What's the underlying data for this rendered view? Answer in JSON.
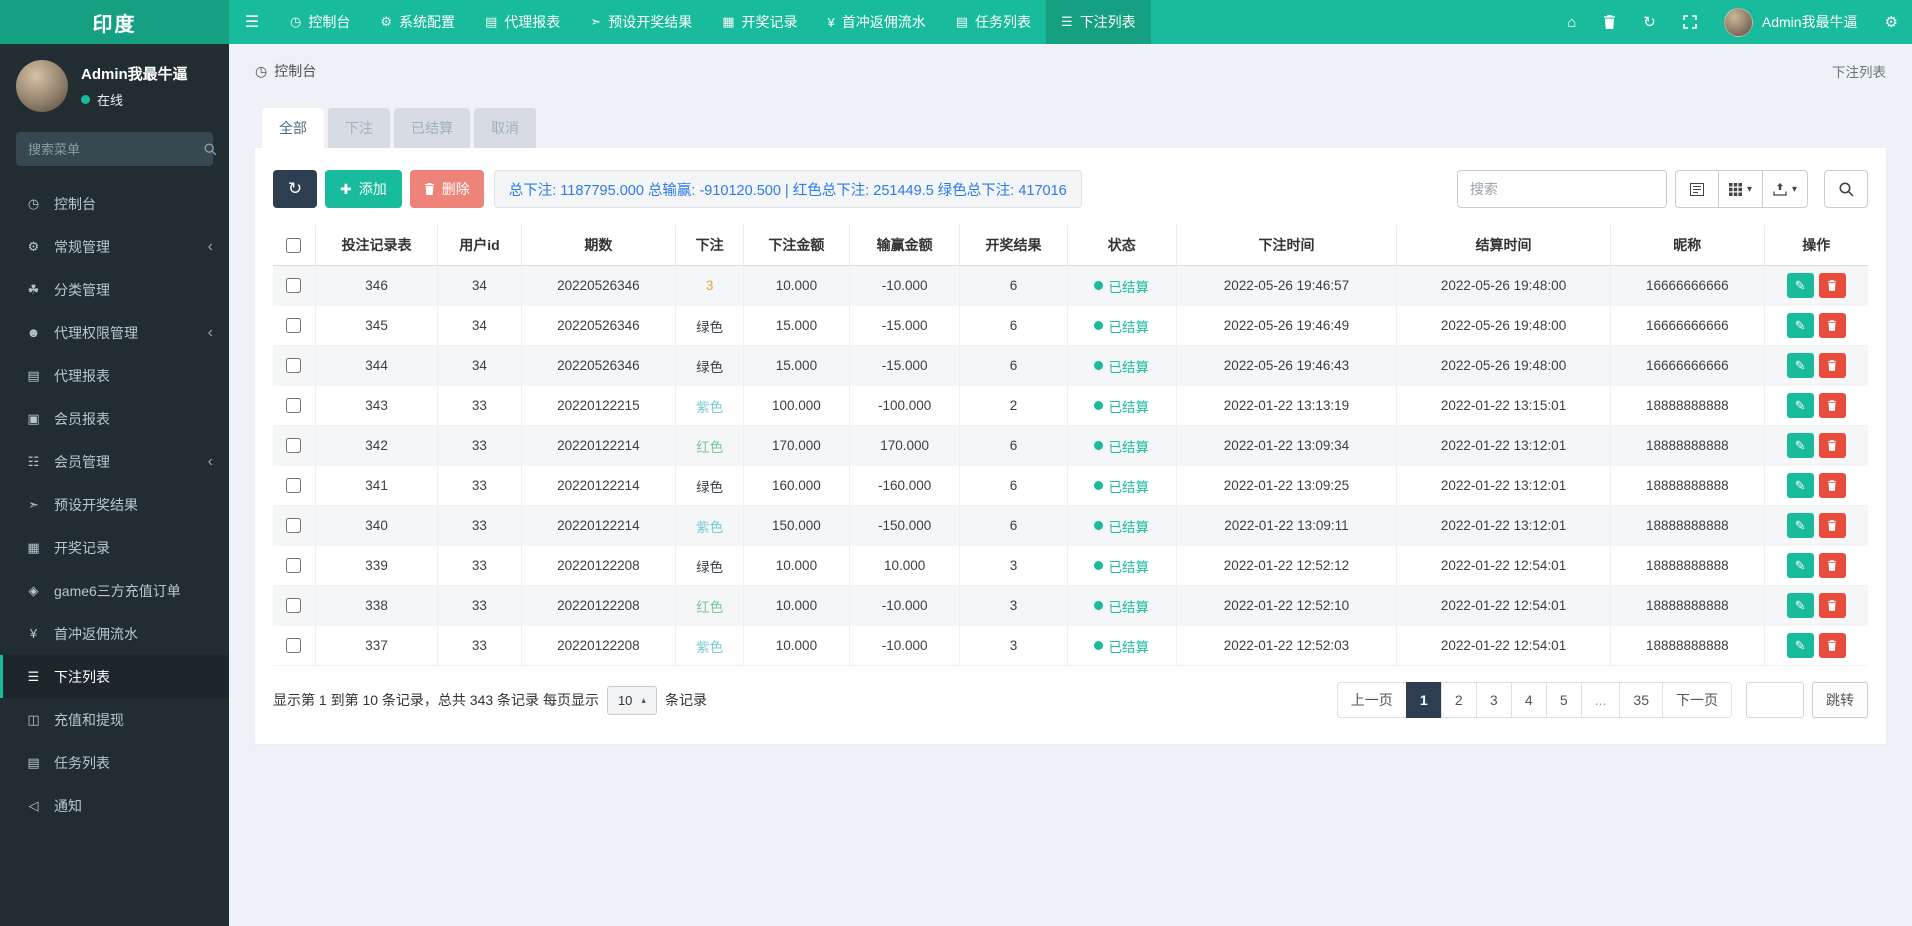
{
  "app": {
    "logo": "印度",
    "admin_name": "Admin我最牛逼"
  },
  "topnav": {
    "items": [
      {
        "label": "控制台",
        "icon": "gauge-icon"
      },
      {
        "label": "系统配置",
        "icon": "gears-icon"
      },
      {
        "label": "代理报表",
        "icon": "book-icon"
      },
      {
        "label": "预设开奖结果",
        "icon": "send-icon"
      },
      {
        "label": "开奖记录",
        "icon": "calendar-icon"
      },
      {
        "label": "首冲返佣流水",
        "icon": "yen-icon"
      },
      {
        "label": "任务列表",
        "icon": "book-icon"
      },
      {
        "label": "下注列表",
        "icon": "list-icon",
        "active": true
      }
    ]
  },
  "sidebar": {
    "user": {
      "name": "Admin我最牛逼",
      "status": "在线"
    },
    "search_placeholder": "搜索菜单",
    "items": [
      {
        "label": "控制台",
        "icon": "gauge-icon"
      },
      {
        "label": "常规管理",
        "icon": "gears-icon",
        "chevron": true
      },
      {
        "label": "分类管理",
        "icon": "leaf-icon"
      },
      {
        "label": "代理权限管理",
        "icon": "users-icon",
        "chevron": true
      },
      {
        "label": "代理报表",
        "icon": "book-icon"
      },
      {
        "label": "会员报表",
        "icon": "idcard-icon"
      },
      {
        "label": "会员管理",
        "icon": "grid-list-icon",
        "chevron": true
      },
      {
        "label": "预设开奖结果",
        "icon": "send-icon"
      },
      {
        "label": "开奖记录",
        "icon": "calendar-icon"
      },
      {
        "label": "game6三方充值订单",
        "icon": "gem-icon"
      },
      {
        "label": "首冲返佣流水",
        "icon": "yen-icon"
      },
      {
        "label": "下注列表",
        "icon": "list-icon",
        "active": true
      },
      {
        "label": "充值和提现",
        "icon": "money-icon"
      },
      {
        "label": "任务列表",
        "icon": "book-icon"
      },
      {
        "label": "通知",
        "icon": "bullhorn-icon"
      }
    ]
  },
  "breadcrumb": {
    "left": "控制台",
    "right": "下注列表"
  },
  "tabs": [
    {
      "label": "全部",
      "active": true
    },
    {
      "label": "下注"
    },
    {
      "label": "已结算"
    },
    {
      "label": "取消"
    }
  ],
  "toolbar": {
    "add_label": "添加",
    "delete_label": "删除",
    "summary": "总下注: 1187795.000 总输赢: -910120.500 | 红色总下注: 251449.5 绿色总下注: 417016",
    "search_placeholder": "搜索"
  },
  "table": {
    "headers": [
      {
        "label": "投注记录表"
      },
      {
        "label": "用户id"
      },
      {
        "label": "期数"
      },
      {
        "label": "下注"
      },
      {
        "label": "下注金额"
      },
      {
        "label": "输赢金额"
      },
      {
        "label": "开奖结果"
      },
      {
        "label": "状态"
      },
      {
        "label": "下注时间"
      },
      {
        "label": "结算时间"
      },
      {
        "label": "昵称"
      },
      {
        "label": "操作"
      }
    ],
    "rows": [
      {
        "record_id": "346",
        "user_id": "34",
        "period": "20220526346",
        "bet": "3",
        "bet_class": "bet-num",
        "amount": "10.000",
        "win_loss": "-10.000",
        "result": "6",
        "status": "已结算",
        "bet_time": "2022-05-26 19:46:57",
        "settle_time": "2022-05-26 19:48:00",
        "nickname": "16666666666"
      },
      {
        "record_id": "345",
        "user_id": "34",
        "period": "20220526346",
        "bet": "绿色",
        "bet_class": "bet-green",
        "amount": "15.000",
        "win_loss": "-15.000",
        "result": "6",
        "status": "已结算",
        "bet_time": "2022-05-26 19:46:49",
        "settle_time": "2022-05-26 19:48:00",
        "nickname": "16666666666"
      },
      {
        "record_id": "344",
        "user_id": "34",
        "period": "20220526346",
        "bet": "绿色",
        "bet_class": "bet-green",
        "amount": "15.000",
        "win_loss": "-15.000",
        "result": "6",
        "status": "已结算",
        "bet_time": "2022-05-26 19:46:43",
        "settle_time": "2022-05-26 19:48:00",
        "nickname": "16666666666"
      },
      {
        "record_id": "343",
        "user_id": "33",
        "period": "20220122215",
        "bet": "紫色",
        "bet_class": "bet-purple",
        "amount": "100.000",
        "win_loss": "-100.000",
        "result": "2",
        "status": "已结算",
        "bet_time": "2022-01-22 13:13:19",
        "settle_time": "2022-01-22 13:15:01",
        "nickname": "18888888888"
      },
      {
        "record_id": "342",
        "user_id": "33",
        "period": "20220122214",
        "bet": "红色",
        "bet_class": "bet-red",
        "amount": "170.000",
        "win_loss": "170.000",
        "result": "6",
        "status": "已结算",
        "bet_time": "2022-01-22 13:09:34",
        "settle_time": "2022-01-22 13:12:01",
        "nickname": "18888888888"
      },
      {
        "record_id": "341",
        "user_id": "33",
        "period": "20220122214",
        "bet": "绿色",
        "bet_class": "bet-green",
        "amount": "160.000",
        "win_loss": "-160.000",
        "result": "6",
        "status": "已结算",
        "bet_time": "2022-01-22 13:09:25",
        "settle_time": "2022-01-22 13:12:01",
        "nickname": "18888888888"
      },
      {
        "record_id": "340",
        "user_id": "33",
        "period": "20220122214",
        "bet": "紫色",
        "bet_class": "bet-purple",
        "amount": "150.000",
        "win_loss": "-150.000",
        "result": "6",
        "status": "已结算",
        "bet_time": "2022-01-22 13:09:11",
        "settle_time": "2022-01-22 13:12:01",
        "nickname": "18888888888"
      },
      {
        "record_id": "339",
        "user_id": "33",
        "period": "20220122208",
        "bet": "绿色",
        "bet_class": "bet-green",
        "amount": "10.000",
        "win_loss": "10.000",
        "result": "3",
        "status": "已结算",
        "bet_time": "2022-01-22 12:52:12",
        "settle_time": "2022-01-22 12:54:01",
        "nickname": "18888888888"
      },
      {
        "record_id": "338",
        "user_id": "33",
        "period": "20220122208",
        "bet": "红色",
        "bet_class": "bet-red",
        "amount": "10.000",
        "win_loss": "-10.000",
        "result": "3",
        "status": "已结算",
        "bet_time": "2022-01-22 12:52:10",
        "settle_time": "2022-01-22 12:54:01",
        "nickname": "18888888888"
      },
      {
        "record_id": "337",
        "user_id": "33",
        "period": "20220122208",
        "bet": "紫色",
        "bet_class": "bet-purple",
        "amount": "10.000",
        "win_loss": "-10.000",
        "result": "3",
        "status": "已结算",
        "bet_time": "2022-01-22 12:52:03",
        "settle_time": "2022-01-22 12:54:01",
        "nickname": "18888888888"
      }
    ]
  },
  "footer": {
    "info_prefix": "显示第 1 到第 10 条记录，总共 343 条记录 每页显示",
    "per_page": "10",
    "info_suffix": "条记录",
    "pages": [
      {
        "label": "上一页"
      },
      {
        "label": "1",
        "active": true
      },
      {
        "label": "2"
      },
      {
        "label": "3"
      },
      {
        "label": "4"
      },
      {
        "label": "5"
      },
      {
        "label": "...",
        "cls": "ellipsis"
      },
      {
        "label": "35"
      },
      {
        "label": "下一页"
      }
    ],
    "jump_label": "跳转"
  },
  "colors": {
    "accent_teal": "#18bc9c",
    "dark_teal": "#15a082",
    "navy": "#2c3e50",
    "danger_red": "#e74c3c",
    "salmon_delete": "#ee837a",
    "summary_blue": "#2d7bea",
    "bet_orange": "#f2a13c",
    "bet_purple_text": "#76ccd2",
    "bet_red_text": "#77c79b",
    "sidebar_bg": "#222d32",
    "content_bg": "#eef1f5"
  }
}
